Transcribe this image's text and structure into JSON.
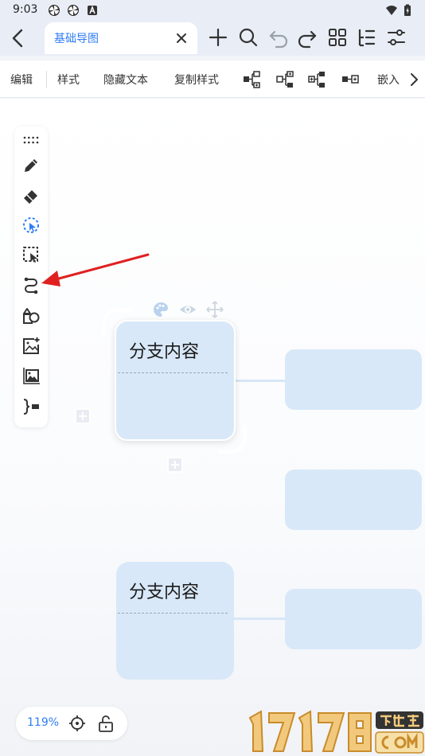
{
  "status_bar": {
    "time": "9:03",
    "icons": [
      "pinwheel-app-icon",
      "pinwheel-app-icon",
      "a-notification-icon",
      "wifi-icon",
      "battery-icon"
    ]
  },
  "topbar": {
    "tab_title": "基础导图",
    "buttons": [
      "back-icon",
      "close-icon",
      "add-icon",
      "search-icon",
      "undo-icon",
      "redo-icon",
      "grid-icon",
      "outline-icon",
      "settings-icon"
    ]
  },
  "format_toolbar": {
    "items": [
      "编辑",
      "样式",
      "隐藏文本",
      "复制样式",
      "嵌入"
    ],
    "icons": [
      "add-child-node-icon",
      "add-sibling-node-icon",
      "add-parent-node-icon",
      "add-left-node-icon",
      "chevron-right-icon"
    ]
  },
  "palette": {
    "tools": [
      "drag-handle-icon",
      "pencil-icon",
      "eraser-icon",
      "lasso-select-icon",
      "selection-box-icon",
      "connection-line-icon",
      "shape-icon",
      "image-add-icon",
      "background-image-icon",
      "summary-icon"
    ]
  },
  "nodes": {
    "selected_title": "分支内容",
    "main_title": "分支内容"
  },
  "zoom": {
    "level": "119%"
  },
  "colors": {
    "accent": "#2f7df6",
    "node_fill": "#d8e8f8",
    "annotation_arrow": "#e02020"
  }
}
